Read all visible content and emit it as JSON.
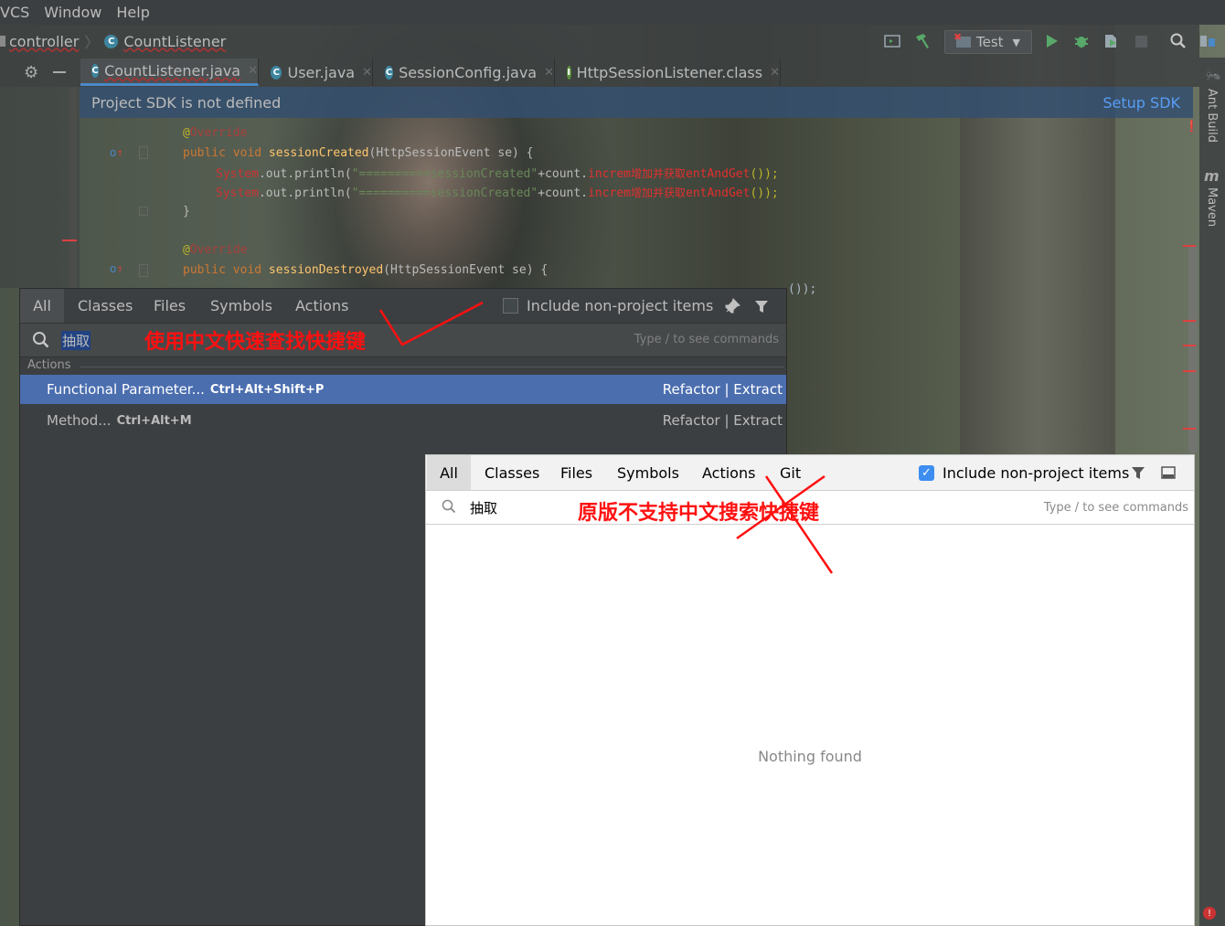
{
  "menu": {
    "items": [
      "VCS",
      "Window",
      "Help"
    ]
  },
  "navbar": {
    "crumbs": [
      "controller",
      "CountListener"
    ],
    "run_config": "Test"
  },
  "tabs": [
    {
      "label": "CountListener.java",
      "active": true
    },
    {
      "label": "User.java"
    },
    {
      "label": "SessionConfig.java"
    },
    {
      "label": "HttpSessionListener.class"
    }
  ],
  "banner": {
    "message": "Project SDK is not defined",
    "link": "Setup SDK"
  },
  "code": {
    "line1": [
      "@",
      "Override"
    ],
    "line2": [
      "public void ",
      "sessionCreated",
      "(HttpSessionEvent se) {"
    ],
    "line3": [
      "System",
      ".out.println(",
      "\"==========sessionCreated\"",
      "+count.",
      "increm",
      "增加并获取",
      "entAndGet",
      "());"
    ],
    "line4": [
      "System",
      ".out.println(",
      "\"==========sessionCreated\"",
      "+count.",
      "increm",
      "增加并获取",
      "entAndGet",
      "());"
    ],
    "line5": "}",
    "line6": [
      "@",
      "Override"
    ],
    "line7": [
      "public void ",
      "sessionDestroyed",
      "(HttpSessionEvent se) {"
    ],
    "line8_tail": "());"
  },
  "popup_dark": {
    "tabs": [
      "All",
      "Classes",
      "Files",
      "Symbols",
      "Actions"
    ],
    "include_label": "Include non-project items",
    "include_checked": false,
    "query": "抽取",
    "hint": "Type / to see commands",
    "section": "Actions",
    "results": [
      {
        "name": "Functional Parameter...",
        "shortcut": "Ctrl+Alt+Shift+P",
        "category": "Refactor | Extract"
      },
      {
        "name": "Method...",
        "shortcut": "Ctrl+Alt+M",
        "category": "Refactor | Extract"
      }
    ]
  },
  "popup_light": {
    "tabs": [
      "All",
      "Classes",
      "Files",
      "Symbols",
      "Actions",
      "Git"
    ],
    "include_label": "Include non-project items",
    "include_checked": true,
    "query": "抽取",
    "hint": "Type / to see commands",
    "empty_text": "Nothing found"
  },
  "annotations": {
    "top": "使用中文快速查找快捷键",
    "bottom": "原版不支持中文搜索快捷键"
  },
  "tool_windows": [
    "Ant Build",
    "Maven"
  ],
  "colors": {
    "accent": "#4b6eaf",
    "link": "#589df6",
    "annotation": "#ff1010"
  }
}
